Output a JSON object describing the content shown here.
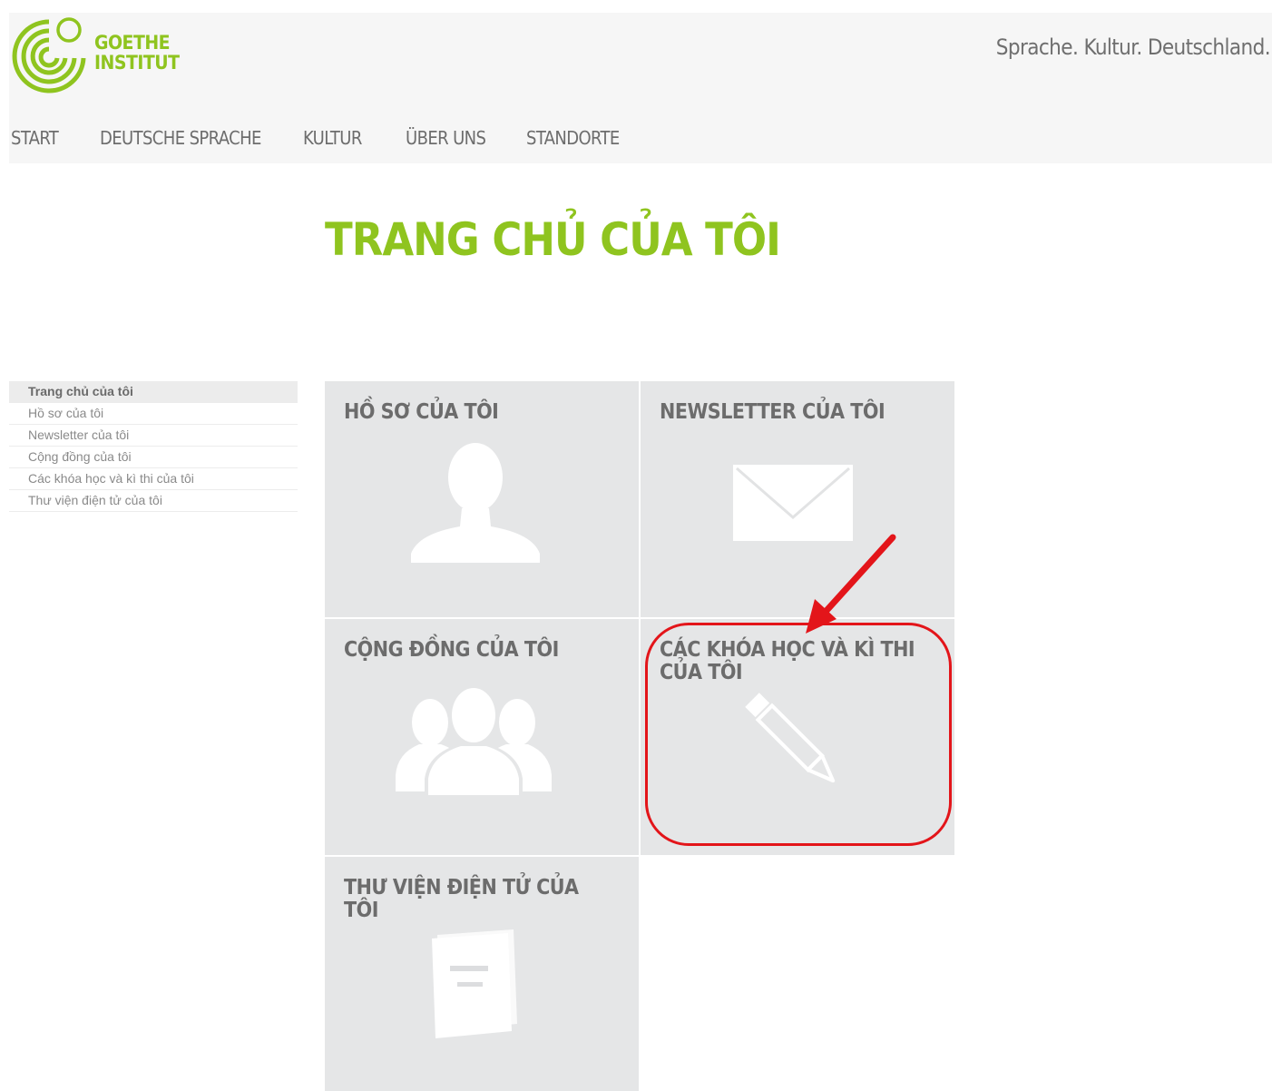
{
  "header": {
    "logo_line1": "GOETHE",
    "logo_line2": "INSTITUT",
    "tagline": "Sprache. Kultur. Deutschland."
  },
  "nav": [
    "START",
    "DEUTSCHE SPRACHE",
    "KULTUR",
    "ÜBER UNS",
    "STANDORTE"
  ],
  "page_title": "TRANG CHỦ CỦA TÔI",
  "sidebar": {
    "items": [
      {
        "label": "Trang chủ của tôi",
        "active": true
      },
      {
        "label": "Hồ sơ của tôi"
      },
      {
        "label": "Newsletter của tôi"
      },
      {
        "label": "Cộng đồng của tôi"
      },
      {
        "label": "Các khóa học và kì thi của tôi"
      },
      {
        "label": "Thư viện điện tử của tôi"
      }
    ]
  },
  "tiles": [
    {
      "label": "HỒ SƠ CỦA TÔI",
      "icon": "person-icon"
    },
    {
      "label": "NEWSLETTER CỦA TÔI",
      "icon": "envelope-icon"
    },
    {
      "label": "CỘNG ĐỒNG CỦA TÔI",
      "icon": "community-icon"
    },
    {
      "label": "CÁC KHÓA HỌC VÀ KÌ THI CỦA TÔI",
      "icon": "pencil-icon"
    },
    {
      "label": "THƯ VIỆN ĐIỆN TỬ CỦA TÔI",
      "icon": "book-icon"
    }
  ],
  "colors": {
    "brand_green": "#8fc41f",
    "tile_bg": "#e5e6e7",
    "annotation_red": "#e3151a"
  }
}
